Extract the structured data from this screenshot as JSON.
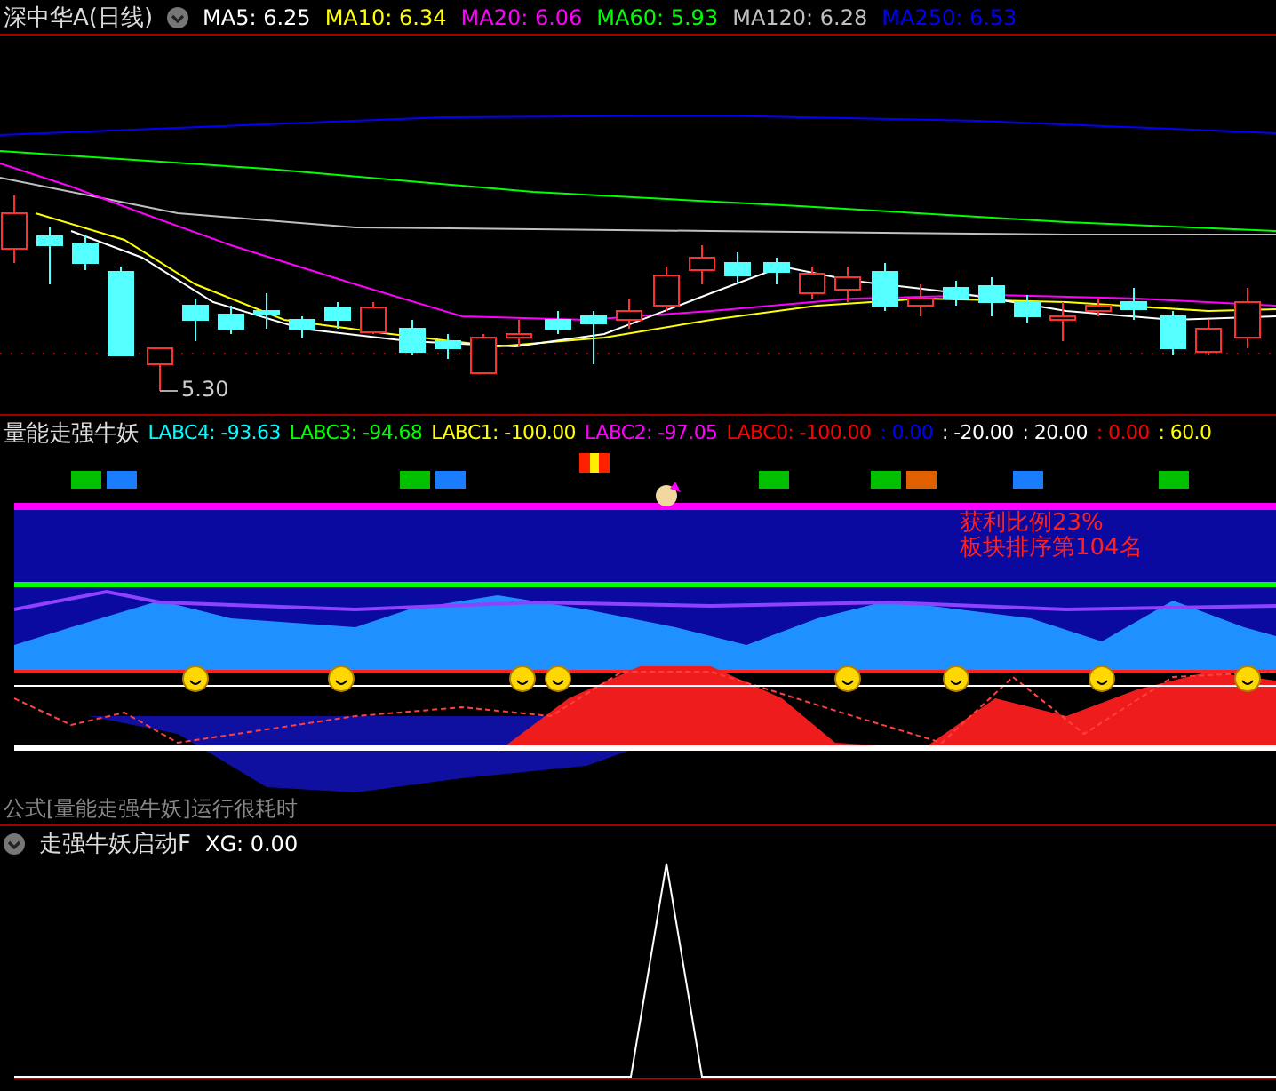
{
  "main_chart": {
    "title": "深中华A(日线)",
    "legend": [
      {
        "text": "MA5: 6.25",
        "color": "#ffffff"
      },
      {
        "text": "MA10: 6.34",
        "color": "#ffff00"
      },
      {
        "text": "MA20: 6.06",
        "color": "#ff00ff"
      },
      {
        "text": "MA60: 5.93",
        "color": "#00ff00"
      },
      {
        "text": "MA120: 6.28",
        "color": "#c0c0c0"
      },
      {
        "text": "MA250: 6.53",
        "color": "#0000ff"
      }
    ],
    "low_label": "5.30"
  },
  "indicator_panel": {
    "title": "量能走强牛妖",
    "legend": [
      {
        "text": "LABC4: -93.63",
        "color": "#00ffff"
      },
      {
        "text": "LABC3: -94.68",
        "color": "#00ff00"
      },
      {
        "text": "LABC1: -100.00",
        "color": "#ffff00"
      },
      {
        "text": "LABC2: -97.05",
        "color": "#ff00ff"
      },
      {
        "text": "LABC0: -100.00",
        "color": "#ff0000"
      },
      {
        "text": ": 0.00",
        "color": "#0000ff"
      },
      {
        "text": ": -20.00",
        "color": "#ffffff"
      },
      {
        "text": ": 20.00",
        "color": "#ffffff"
      },
      {
        "text": ": 0.00",
        "color": "#ff0000"
      },
      {
        "text": ": 60.0",
        "color": "#ffff00"
      }
    ],
    "notes": [
      "获利比例23%",
      "板块排序第104名"
    ],
    "footnote": "公式[量能走强牛妖]运行很耗时"
  },
  "signal_panel": {
    "title": "走强牛妖启动F",
    "legend": [
      {
        "text": "XG: 0.00",
        "color": "#ffffff"
      }
    ]
  }
}
